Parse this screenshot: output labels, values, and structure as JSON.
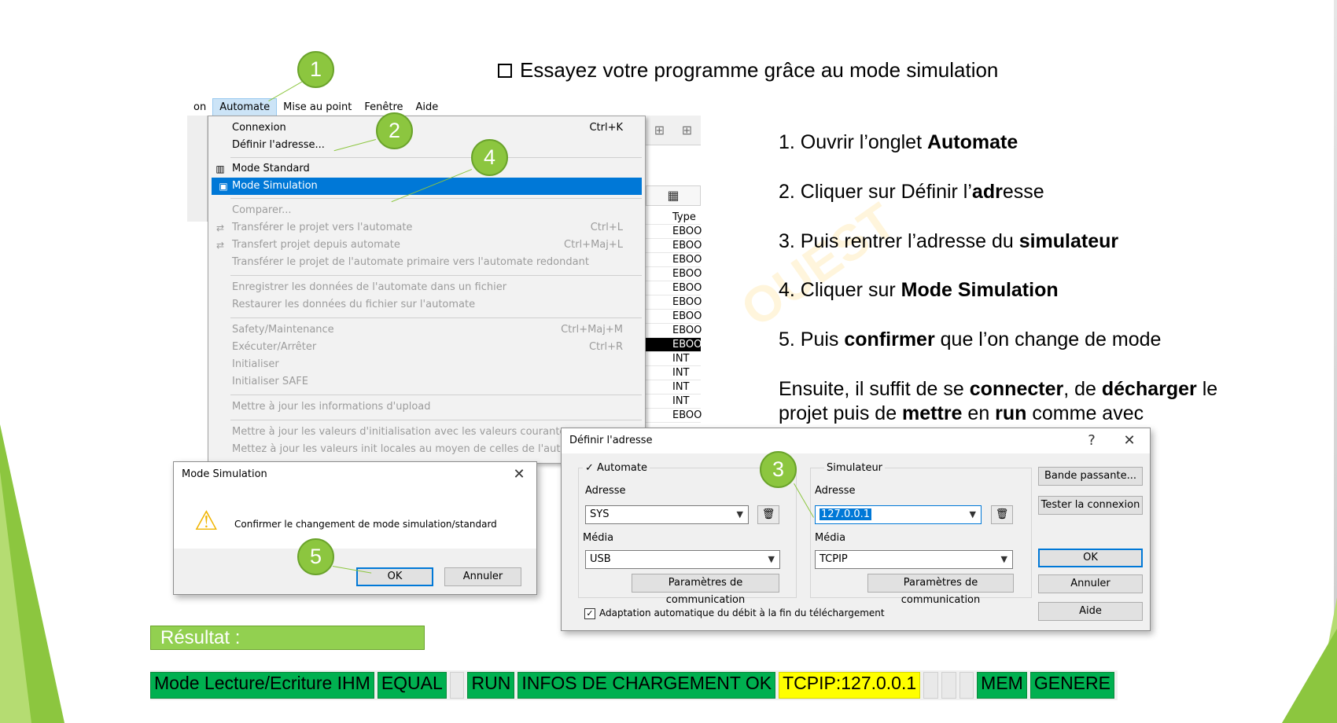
{
  "heading": "Essayez votre programme grâce au mode simulation",
  "watermark": "OUEST",
  "steps": {
    "s1_pre": "1. Ouvrir l’onglet ",
    "s1_bold": "Automate",
    "s2_pre": "2. Cliquer sur Définir l’",
    "s2_bold": "adr",
    "s2_post": "esse",
    "s3_pre": "3. Puis rentrer l’adresse du ",
    "s3_bold": "simulateur",
    "s4_pre": "4. Cliquer sur ",
    "s4_bold": "Mode Simulation",
    "s5_pre": "5. Puis ",
    "s5_bold": "confirmer",
    "s5_post": " que l’on change de mode",
    "then_1": "Ensuite, il suffit de se ",
    "then_b1": "connecter",
    "then_2": ", de ",
    "then_b2": "décharger",
    "then_3": " le",
    "then_4": "projet puis de ",
    "then_b3": "mettre",
    "then_5": " en ",
    "then_b4": "run",
    "then_6": " comme avec"
  },
  "menubar": {
    "items": [
      "on",
      "Automate",
      "Mise au point",
      "Fenêtre",
      "Aide"
    ]
  },
  "dropdown": {
    "connexion": "Connexion",
    "connexion_sc": "Ctrl+K",
    "definir": "Définir l'adresse...",
    "mode_standard": "Mode Standard",
    "mode_simulation": "Mode Simulation",
    "comparer": "Comparer...",
    "transferer": "Transférer le projet vers l'automate",
    "transferer_sc": "Ctrl+L",
    "transfert_depuis": "Transfert projet depuis automate",
    "transfert_depuis_sc": "Ctrl+Maj+L",
    "transferer_redondant": "Transférer le projet de l'automate primaire vers l'automate redondant",
    "enregistrer": "Enregistrer les données de l'automate dans un fichier",
    "restaurer": "Restaurer les données du fichier sur l'automate",
    "safety": "Safety/Maintenance",
    "safety_sc": "Ctrl+Maj+M",
    "executer": "Exécuter/Arrêter",
    "executer_sc": "Ctrl+R",
    "initialiser": "Initialiser",
    "initialiser_safe": "Initialiser SAFE",
    "mettre_upload": "Mettre à jour les informations d'upload",
    "mettre_valeurs": "Mettre à jour les valeurs d'initialisation avec les valeurs courantes",
    "mettez_locales": "Mettez à jour les valeurs init locales au moyen de celles de l'automate"
  },
  "type_column": {
    "header": "Type",
    "rows": [
      "EBOO",
      "EBOO",
      "EBOO",
      "EBOO",
      "EBOO",
      "EBOO",
      "EBOO",
      "EBOO",
      "EBOO",
      "INT",
      "INT",
      "INT",
      "INT",
      "EBOO"
    ]
  },
  "dlg_simulation": {
    "title": "Mode Simulation",
    "message": "Confirmer le changement de mode simulation/standard",
    "ok": "OK",
    "cancel": "Annuler"
  },
  "dlg_adresse": {
    "title": "Définir l'adresse",
    "help_glyph": "?",
    "automate_label": "Automate",
    "simulateur_label": "Simulateur",
    "adresse_label": "Adresse",
    "adresse_auto_value": "SYS",
    "adresse_sim_value": "127.0.0.1",
    "media_label": "Média",
    "media_auto_value": "USB",
    "media_sim_value": "TCPIP",
    "param_comm": "Paramètres de communication",
    "bande_passante": "Bande passante...",
    "tester": "Tester la connexion",
    "ok": "OK",
    "annuler": "Annuler",
    "aide": "Aide",
    "adaptation": "Adaptation automatique du débit à la fin du téléchargement"
  },
  "callouts": [
    "1",
    "2",
    "3",
    "4",
    "5"
  ],
  "resultat_label": "Résultat :",
  "statusbar": {
    "mode": "Mode Lecture/Ecriture IHM",
    "equal": "EQUAL",
    "run": "RUN",
    "infos": "INFOS DE CHARGEMENT OK",
    "tcpip": "TCPIP:127.0.0.1",
    "mem": "MEM",
    "genere": "GENERE"
  },
  "colors": {
    "accent_green": "#8cc63f",
    "status_green": "#00b050",
    "status_yellow": "#ffff00",
    "highlight_blue": "#0078d7"
  }
}
